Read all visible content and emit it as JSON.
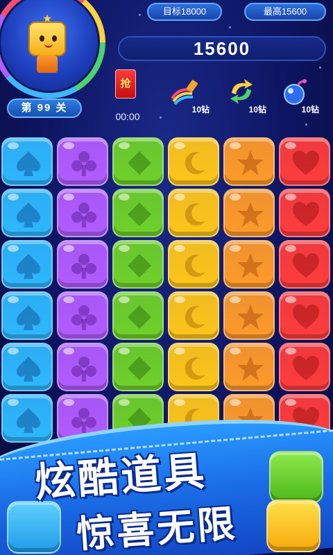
{
  "header": {
    "target_label": "目标18000",
    "best_label": "最高15600",
    "score": "15600",
    "level_label": "第 99 关"
  },
  "powerups": {
    "redpack_label": "抢",
    "timer": "00:00",
    "items": [
      {
        "icon": "rainbow-brush-icon",
        "cost": "10钻"
      },
      {
        "icon": "swap-arrows-icon",
        "cost": "10钻"
      },
      {
        "icon": "bomb-icon",
        "cost": "10钻"
      }
    ]
  },
  "board": {
    "columns": [
      {
        "suit": "spade",
        "color": "#2fb8ff"
      },
      {
        "suit": "club",
        "color": "#b25cff"
      },
      {
        "suit": "diamond",
        "color": "#6fd12a"
      },
      {
        "suit": "moon",
        "color": "#ffc61a"
      },
      {
        "suit": "star",
        "color": "#ff9b2a"
      },
      {
        "suit": "heart",
        "color": "#ff3d3d"
      }
    ],
    "rows": 6
  },
  "banner": {
    "line1": "炫酷道具",
    "line2": "惊喜无限"
  },
  "colors": {
    "background": "#0d1460",
    "accent": "#2d6fe0"
  }
}
